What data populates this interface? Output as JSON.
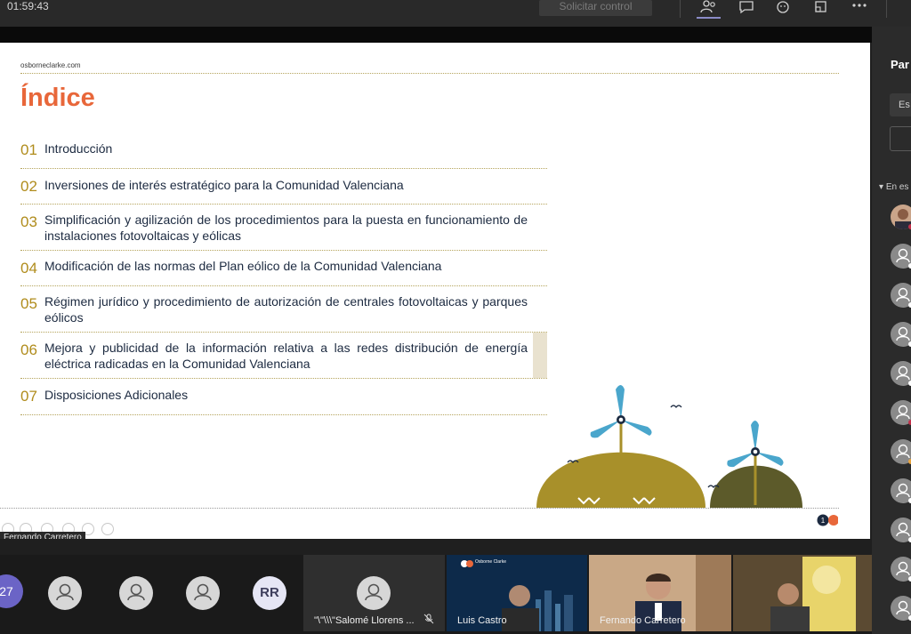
{
  "meeting": {
    "elapsed": "01:59:43",
    "control_button": "Solicitar control"
  },
  "slide": {
    "site": "osborneclarke.com",
    "title": "Índice",
    "items": [
      {
        "num": "01",
        "text": "Introducción"
      },
      {
        "num": "02",
        "text": "Inversiones de interés estratégico para la Comunidad Valenciana"
      },
      {
        "num": "03",
        "text": "Simplificación y agilización de los procedimientos para la puesta en funcionamiento de instalaciones fotovoltaicas y eólicas"
      },
      {
        "num": "04",
        "text": "Modificación de las normas del Plan eólico de la Comunidad Valenciana"
      },
      {
        "num": "05",
        "text": "Régimen jurídico y procedimiento de autorización de centrales fotovoltaicas y parques eólicos"
      },
      {
        "num": "06",
        "text": "Mejora y publicidad de la información relativa a las redes distribución de energía eléctrica radicadas en la Comunidad Valenciana"
      },
      {
        "num": "07",
        "text": "Disposiciones Adicionales"
      }
    ],
    "page_badge": "1",
    "presenter_label": "Fernando Carretero"
  },
  "side_panel": {
    "title_partial": "Par",
    "search_partial": "Es",
    "section_partial": "En es",
    "status_colors": [
      "#c4314b",
      "#ffffff",
      "#ffffff",
      "#ffffff",
      "#ffffff",
      "#c4314b",
      "#e8a33d",
      "#ffffff",
      "#ffffff",
      "#ffffff",
      "#ffffff"
    ]
  },
  "participants": {
    "overflow_count": "27",
    "initials": "RR",
    "audio_tile_name": "\"\\\"\\\\\\\"Salomé Llorens ...",
    "video_tiles": [
      {
        "name": "Luis Castro",
        "logo_text": "Osborne Clarke"
      },
      {
        "name": "Fernando Carretero"
      },
      {
        "name": ""
      }
    ]
  },
  "colors": {
    "accent_orange": "#e8673a",
    "gold": "#b08c1c",
    "dark_olive": "#5c5a2a",
    "teams_purple": "#6b64c6"
  }
}
